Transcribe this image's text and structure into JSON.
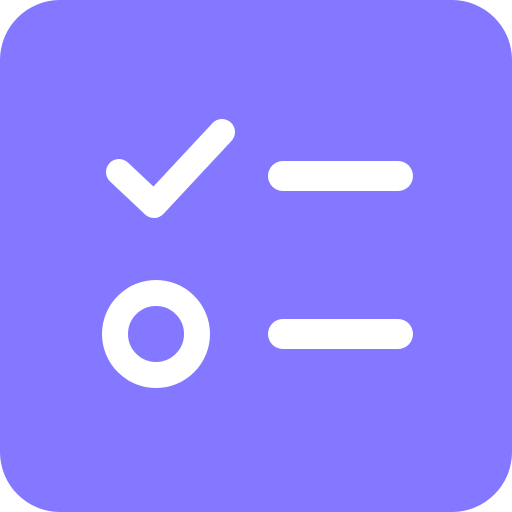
{
  "icon": {
    "name": "checklist-app-icon",
    "background_color": "#8378FF",
    "foreground_color": "#FFFFFF"
  },
  "items": [
    {
      "state": "checked",
      "marker_icon": "checkmark-icon",
      "line_icon": "text-line-icon"
    },
    {
      "state": "unchecked",
      "marker_icon": "circle-icon",
      "line_icon": "text-line-icon"
    }
  ]
}
